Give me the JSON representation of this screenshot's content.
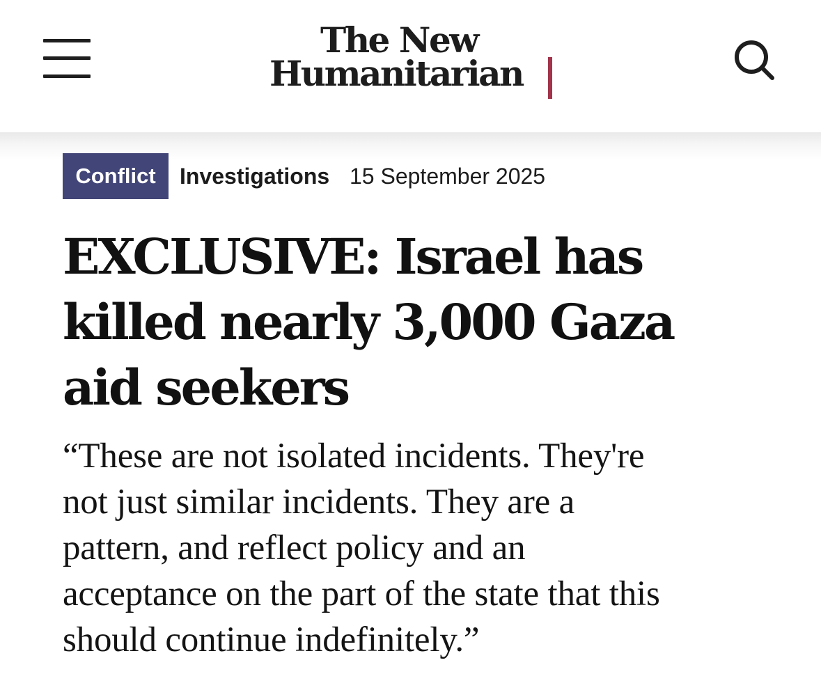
{
  "header": {
    "menu_icon": "hamburger-menu-icon",
    "logo_line1": "The New",
    "logo_line2": "Humanitarian",
    "logo_accent_color": "#a2344b",
    "search_icon": "search-icon"
  },
  "article": {
    "tag": "Conflict",
    "tag_color": "#424577",
    "section": "Investigations",
    "date": "15 September 2025",
    "headline_lines": [
      "EXCLUSIVE: Israel has",
      "killed nearly 3,000 Gaza",
      "aid seekers"
    ],
    "quote_lines": [
      "“These are not isolated incidents. They're",
      "not just similar incidents. They are a",
      "pattern, and reflect policy and an",
      "acceptance on the part of the state that this",
      "should continue indefinitely.”"
    ]
  }
}
